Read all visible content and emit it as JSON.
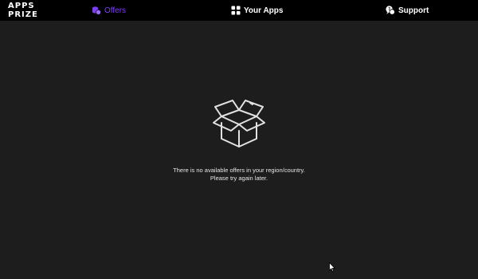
{
  "app": {
    "logo_line1": "APPS",
    "logo_line2": "PRIZE"
  },
  "nav": {
    "offers": "Offers",
    "your_apps": "Your Apps",
    "support": "Support"
  },
  "empty_state": {
    "line1": "There is no available offers in your region/country.",
    "line2": "Please try again later."
  },
  "colors": {
    "accent": "#7b3ff2",
    "background": "#1d1d1d",
    "topbar": "#000000"
  },
  "icons": [
    "coins-icon",
    "apps-grid-icon",
    "support-chat-icon",
    "open-box-icon",
    "mouse-cursor-icon"
  ]
}
